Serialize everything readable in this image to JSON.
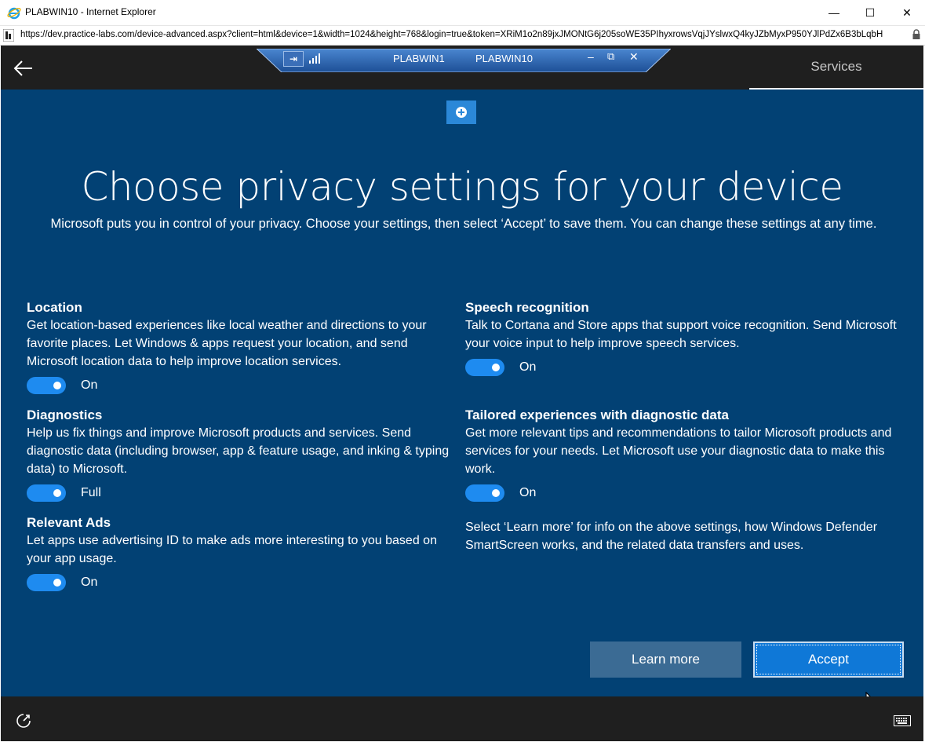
{
  "window": {
    "title": "PLABWIN10 - Internet Explorer",
    "minimize_glyph": "—",
    "maximize_glyph": "☐",
    "close_glyph": "✕"
  },
  "address": {
    "url": "https://dev.practice-labs.com/device-advanced.aspx?client=html&device=1&width=1024&height=768&login=true&token=XRiM1o2n89jxJMONtG6j205soWE35PIhyxrowsVqjJYslwxQ4kyJZbMyxP950YJlPdZx6B3bLqbH"
  },
  "connection_bar": {
    "title_left": "PLABWIN1",
    "title_right": "PLABWIN10",
    "pin_glyph": "⇥",
    "min_glyph": "–",
    "restore_glyph": "⧉",
    "close_glyph": "✕"
  },
  "oobe": {
    "tab_label": "Services",
    "heading": "Choose privacy settings for your device",
    "subtitle": "Microsoft puts you in control of your privacy. Choose your settings, then select ‘Accept’ to save them. You can change these settings at any time.",
    "settings": {
      "location": {
        "title": "Location",
        "description": "Get location-based experiences like local weather and directions to your favorite places. Let Windows & apps request your location, and send Microsoft location data to help improve location services.",
        "state": "On"
      },
      "diagnostics": {
        "title": "Diagnostics",
        "description": "Help us fix things and improve Microsoft products and services. Send diagnostic data (including browser, app & feature usage, and inking & typing data) to Microsoft.",
        "state": "Full"
      },
      "ads": {
        "title": "Relevant Ads",
        "description": "Let apps use advertising ID to make ads more interesting to you based on your app usage.",
        "state": "On"
      },
      "speech": {
        "title": "Speech recognition",
        "description": "Talk to Cortana and Store apps that support voice recognition. Send Microsoft your voice input to help improve speech services.",
        "state": "On"
      },
      "tailored": {
        "title": "Tailored experiences with diagnostic data",
        "description": "Get more relevant tips and recommendations to tailor Microsoft products and services for your needs. Let Microsoft use your diagnostic data to make this work.",
        "state": "On"
      }
    },
    "learn_note": "Select ‘Learn more’ for info on the above settings, how Windows Defender SmartScreen works, and the related data transfers and uses.",
    "learn_more_label": "Learn more",
    "accept_label": "Accept"
  },
  "colors": {
    "background": "#024174",
    "toggle_on": "#1e8bf0",
    "accept": "#0f78d7",
    "learn_more": "#3b6b94"
  }
}
